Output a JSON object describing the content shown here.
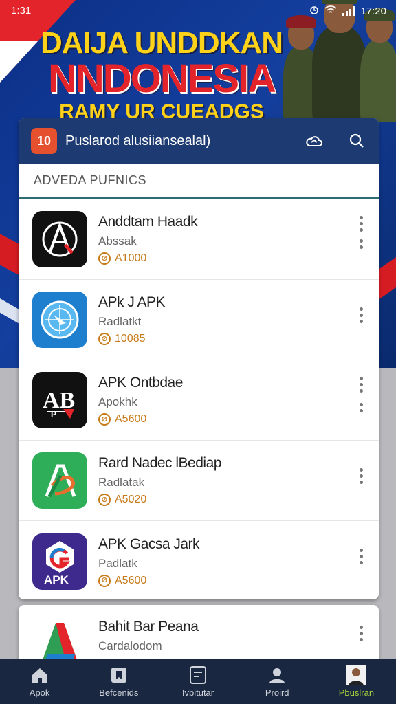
{
  "status_bar": {
    "time": "1:31",
    "clock_right": "17:20"
  },
  "banner": {
    "line1": "DAIJA UNDDKAN",
    "line2": "NNDONESIA",
    "line3": "RAMY UR CUEADGS"
  },
  "card": {
    "logo_text": "10",
    "title": "Puslarod alusiiansealal)",
    "section_heading": "ADVEDA PUFNICS",
    "items": [
      {
        "name": "Anddtam Haadk",
        "subtitle": "Abssak",
        "meta": "A1000",
        "icon": "letter-a-icon"
      },
      {
        "name": "APk J APK",
        "subtitle": "Radlatkt",
        "meta": "10085",
        "icon": "compass-icon"
      },
      {
        "name": "APK Ontbdae",
        "subtitle": "Apokhk",
        "meta": "A5600",
        "icon": "ab-logo-icon"
      },
      {
        "name": "Rard Nadec lBediap",
        "subtitle": "Radlatak",
        "meta": "A5020",
        "icon": "green-a-icon"
      },
      {
        "name": "APK Gacsa Jark",
        "subtitle": "Padlatk",
        "meta": "A5600",
        "icon": "apk-g-icon"
      }
    ]
  },
  "card2": {
    "item": {
      "name": "Bahit Bar Peana",
      "subtitle": "Cardalodom",
      "icon": "triangle-a-icon"
    }
  },
  "bottom_nav": [
    {
      "label": "Apok",
      "icon": "home-icon",
      "active": false
    },
    {
      "label": "Befcenids",
      "icon": "bookmark-icon",
      "active": false
    },
    {
      "label": "Ivbitutar",
      "icon": "list-icon",
      "active": false
    },
    {
      "label": "Proird",
      "icon": "profile-icon",
      "active": false
    },
    {
      "label": "Pbuslran",
      "icon": "avatar-icon",
      "active": true
    }
  ],
  "colors": {
    "header": "#1d3b72",
    "accent_red": "#e3242b",
    "accent_yellow": "#ffd21a",
    "nav_active": "#a6d33b",
    "meta": "#c77a18"
  }
}
